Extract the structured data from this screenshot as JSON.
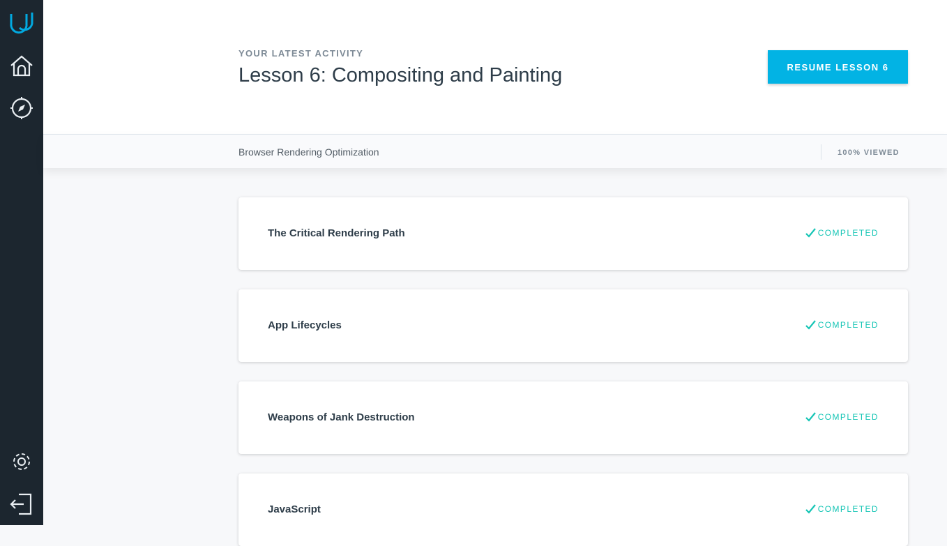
{
  "sidebar": {
    "items": [
      {
        "icon": "udacity-logo-icon"
      },
      {
        "icon": "home-icon"
      },
      {
        "icon": "compass-icon"
      },
      {
        "icon": "gear-icon"
      },
      {
        "icon": "logout-icon"
      }
    ]
  },
  "header": {
    "eyebrow": "YOUR LATEST ACTIVITY",
    "title": "Lesson 6: Compositing and Painting",
    "resume_label": "RESUME LESSON 6"
  },
  "subbar": {
    "course": "Browser Rendering Optimization",
    "progress": "100% VIEWED",
    "progress_percent": 100
  },
  "colors": {
    "accent": "#02b3e4",
    "completed": "#15c5b5",
    "sidebar": "#1c262f"
  },
  "lessons": [
    {
      "name": "The Critical Rendering Path",
      "status": "COMPLETED"
    },
    {
      "name": "App Lifecycles",
      "status": "COMPLETED"
    },
    {
      "name": "Weapons of Jank Destruction",
      "status": "COMPLETED"
    },
    {
      "name": "JavaScript",
      "status": "COMPLETED"
    }
  ]
}
